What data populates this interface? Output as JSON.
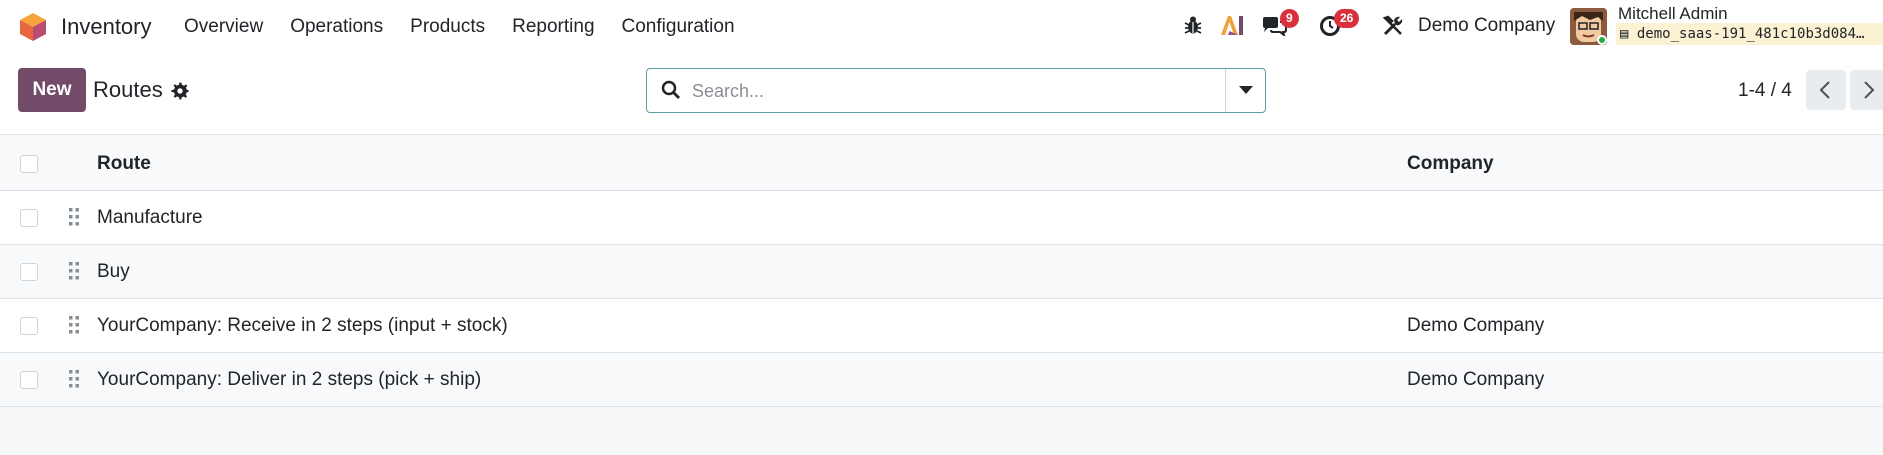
{
  "app": {
    "name": "Inventory",
    "menu": [
      "Overview",
      "Operations",
      "Products",
      "Reporting",
      "Configuration"
    ]
  },
  "systray": {
    "messages_count": "9",
    "activities_count": "26",
    "company": "Demo Company",
    "user_name": "Mitchell Admin",
    "database": "demo_saas-191_481c10b3d084…"
  },
  "control": {
    "new_label": "New",
    "breadcrumb": "Routes",
    "search_placeholder": "Search...",
    "pager": "1-4 / 4"
  },
  "table": {
    "headers": {
      "route": "Route",
      "company": "Company"
    },
    "rows": [
      {
        "route": "Manufacture",
        "company": ""
      },
      {
        "route": "Buy",
        "company": ""
      },
      {
        "route": "YourCompany: Receive in 2 steps (input + stock)",
        "company": "Demo Company"
      },
      {
        "route": "YourCompany: Deliver in 2 steps (pick + ship)",
        "company": "Demo Company"
      }
    ]
  },
  "colors": {
    "primary": "#714b67",
    "badge": "#d9303e",
    "search_border": "#5f9ea8"
  }
}
